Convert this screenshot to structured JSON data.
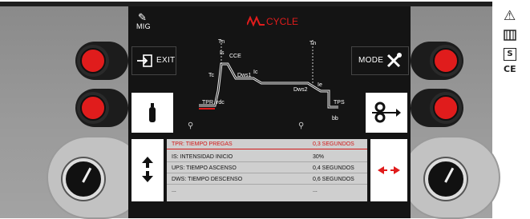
{
  "header": {
    "mode_label": "MIG",
    "brand": "CYCLE"
  },
  "left_buttons": {
    "exit_label": "EXIT"
  },
  "right_buttons": {
    "mode_label": "MODE"
  },
  "graph_labels": {
    "tn1": "Tn",
    "is": "Is",
    "cce": "CCE",
    "tc": "Tc",
    "dws1": "Dws1",
    "ic": "Ic",
    "tpr": "TPR",
    "rdc": "rdc",
    "tn2": "Tn",
    "dws2": "Dws2",
    "ie": "Ie",
    "tps": "TPS",
    "bb": "bb"
  },
  "params": [
    {
      "name": "TPR: TIEMPO PREGAS",
      "value": "0,3 SEGUNDOS",
      "selected": true
    },
    {
      "name": "IS: INTENSIDAD INICIO",
      "value": "30%",
      "selected": false
    },
    {
      "name": "UPS: TIEMPO ASCENSO",
      "value": "0,4 SEGUNDOS",
      "selected": false
    },
    {
      "name": "DWS: TIEMPO DESCENSO",
      "value": "0,6 SEGUNDOS",
      "selected": false
    },
    {
      "name": "...",
      "value": "...",
      "selected": false
    }
  ],
  "colors": {
    "accent_red": "#e01c1c",
    "screen_bg": "#141414",
    "panel_gray": "#9a9a9a"
  },
  "side_icons": [
    "warning-icon",
    "book-icon",
    "s-mark-icon",
    "ce-mark-icon"
  ],
  "side_text": {
    "s_mark": "S",
    "ce_mark": "CE"
  }
}
